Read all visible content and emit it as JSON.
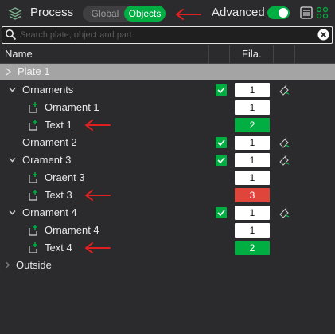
{
  "toolbar": {
    "title": "Process",
    "mode_global": "Global",
    "mode_objects": "Objects",
    "selected_mode": "Objects",
    "advanced_label": "Advanced",
    "advanced_on": true,
    "accent_color": "#00ae42"
  },
  "search": {
    "placeholder": "Search plate, object and part."
  },
  "columns": {
    "name": "Name",
    "filament": "Fila."
  },
  "plate": {
    "label": "Plate 1"
  },
  "rows": [
    {
      "label": "Ornaments",
      "fila": "1",
      "fila_color": "white",
      "checked": true
    },
    {
      "label": "Ornament 1",
      "fila": "1",
      "fila_color": "white"
    },
    {
      "label": "Text 1",
      "fila": "2",
      "fila_color": "green"
    },
    {
      "label": "Ornament 2",
      "fila": "1",
      "fila_color": "white",
      "checked": true
    },
    {
      "label": "Orament 3",
      "fila": "1",
      "fila_color": "white",
      "checked": true
    },
    {
      "label": "Oraent 3",
      "fila": "1",
      "fila_color": "white"
    },
    {
      "label": "Text 3",
      "fila": "3",
      "fila_color": "red"
    },
    {
      "label": "Ornament 4",
      "fila": "1",
      "fila_color": "white",
      "checked": true
    },
    {
      "label": "Ornament 4",
      "fila": "1",
      "fila_color": "white"
    },
    {
      "label": "Text 4",
      "fila": "2",
      "fila_color": "green"
    },
    {
      "label": "Outside"
    }
  ],
  "annotation_color": "#e02020"
}
